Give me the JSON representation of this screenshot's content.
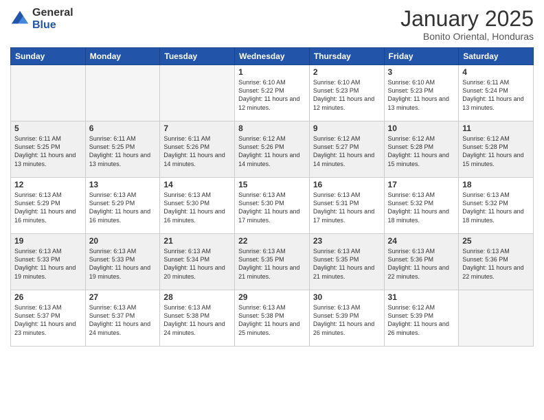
{
  "logo": {
    "general": "General",
    "blue": "Blue"
  },
  "header": {
    "month": "January 2025",
    "location": "Bonito Oriental, Honduras"
  },
  "weekdays": [
    "Sunday",
    "Monday",
    "Tuesday",
    "Wednesday",
    "Thursday",
    "Friday",
    "Saturday"
  ],
  "weeks": [
    [
      {
        "day": "",
        "empty": true
      },
      {
        "day": "",
        "empty": true
      },
      {
        "day": "",
        "empty": true
      },
      {
        "day": "1",
        "info": "Sunrise: 6:10 AM\nSunset: 5:22 PM\nDaylight: 11 hours and 12 minutes."
      },
      {
        "day": "2",
        "info": "Sunrise: 6:10 AM\nSunset: 5:23 PM\nDaylight: 11 hours and 12 minutes."
      },
      {
        "day": "3",
        "info": "Sunrise: 6:10 AM\nSunset: 5:23 PM\nDaylight: 11 hours and 13 minutes."
      },
      {
        "day": "4",
        "info": "Sunrise: 6:11 AM\nSunset: 5:24 PM\nDaylight: 11 hours and 13 minutes."
      }
    ],
    [
      {
        "day": "5",
        "info": "Sunrise: 6:11 AM\nSunset: 5:25 PM\nDaylight: 11 hours and 13 minutes."
      },
      {
        "day": "6",
        "info": "Sunrise: 6:11 AM\nSunset: 5:25 PM\nDaylight: 11 hours and 13 minutes."
      },
      {
        "day": "7",
        "info": "Sunrise: 6:11 AM\nSunset: 5:26 PM\nDaylight: 11 hours and 14 minutes."
      },
      {
        "day": "8",
        "info": "Sunrise: 6:12 AM\nSunset: 5:26 PM\nDaylight: 11 hours and 14 minutes."
      },
      {
        "day": "9",
        "info": "Sunrise: 6:12 AM\nSunset: 5:27 PM\nDaylight: 11 hours and 14 minutes."
      },
      {
        "day": "10",
        "info": "Sunrise: 6:12 AM\nSunset: 5:28 PM\nDaylight: 11 hours and 15 minutes."
      },
      {
        "day": "11",
        "info": "Sunrise: 6:12 AM\nSunset: 5:28 PM\nDaylight: 11 hours and 15 minutes."
      }
    ],
    [
      {
        "day": "12",
        "info": "Sunrise: 6:13 AM\nSunset: 5:29 PM\nDaylight: 11 hours and 16 minutes."
      },
      {
        "day": "13",
        "info": "Sunrise: 6:13 AM\nSunset: 5:29 PM\nDaylight: 11 hours and 16 minutes."
      },
      {
        "day": "14",
        "info": "Sunrise: 6:13 AM\nSunset: 5:30 PM\nDaylight: 11 hours and 16 minutes."
      },
      {
        "day": "15",
        "info": "Sunrise: 6:13 AM\nSunset: 5:30 PM\nDaylight: 11 hours and 17 minutes."
      },
      {
        "day": "16",
        "info": "Sunrise: 6:13 AM\nSunset: 5:31 PM\nDaylight: 11 hours and 17 minutes."
      },
      {
        "day": "17",
        "info": "Sunrise: 6:13 AM\nSunset: 5:32 PM\nDaylight: 11 hours and 18 minutes."
      },
      {
        "day": "18",
        "info": "Sunrise: 6:13 AM\nSunset: 5:32 PM\nDaylight: 11 hours and 18 minutes."
      }
    ],
    [
      {
        "day": "19",
        "info": "Sunrise: 6:13 AM\nSunset: 5:33 PM\nDaylight: 11 hours and 19 minutes."
      },
      {
        "day": "20",
        "info": "Sunrise: 6:13 AM\nSunset: 5:33 PM\nDaylight: 11 hours and 19 minutes."
      },
      {
        "day": "21",
        "info": "Sunrise: 6:13 AM\nSunset: 5:34 PM\nDaylight: 11 hours and 20 minutes."
      },
      {
        "day": "22",
        "info": "Sunrise: 6:13 AM\nSunset: 5:35 PM\nDaylight: 11 hours and 21 minutes."
      },
      {
        "day": "23",
        "info": "Sunrise: 6:13 AM\nSunset: 5:35 PM\nDaylight: 11 hours and 21 minutes."
      },
      {
        "day": "24",
        "info": "Sunrise: 6:13 AM\nSunset: 5:36 PM\nDaylight: 11 hours and 22 minutes."
      },
      {
        "day": "25",
        "info": "Sunrise: 6:13 AM\nSunset: 5:36 PM\nDaylight: 11 hours and 22 minutes."
      }
    ],
    [
      {
        "day": "26",
        "info": "Sunrise: 6:13 AM\nSunset: 5:37 PM\nDaylight: 11 hours and 23 minutes."
      },
      {
        "day": "27",
        "info": "Sunrise: 6:13 AM\nSunset: 5:37 PM\nDaylight: 11 hours and 24 minutes."
      },
      {
        "day": "28",
        "info": "Sunrise: 6:13 AM\nSunset: 5:38 PM\nDaylight: 11 hours and 24 minutes."
      },
      {
        "day": "29",
        "info": "Sunrise: 6:13 AM\nSunset: 5:38 PM\nDaylight: 11 hours and 25 minutes."
      },
      {
        "day": "30",
        "info": "Sunrise: 6:13 AM\nSunset: 5:39 PM\nDaylight: 11 hours and 26 minutes."
      },
      {
        "day": "31",
        "info": "Sunrise: 6:12 AM\nSunset: 5:39 PM\nDaylight: 11 hours and 26 minutes."
      },
      {
        "day": "",
        "empty": true
      }
    ]
  ]
}
